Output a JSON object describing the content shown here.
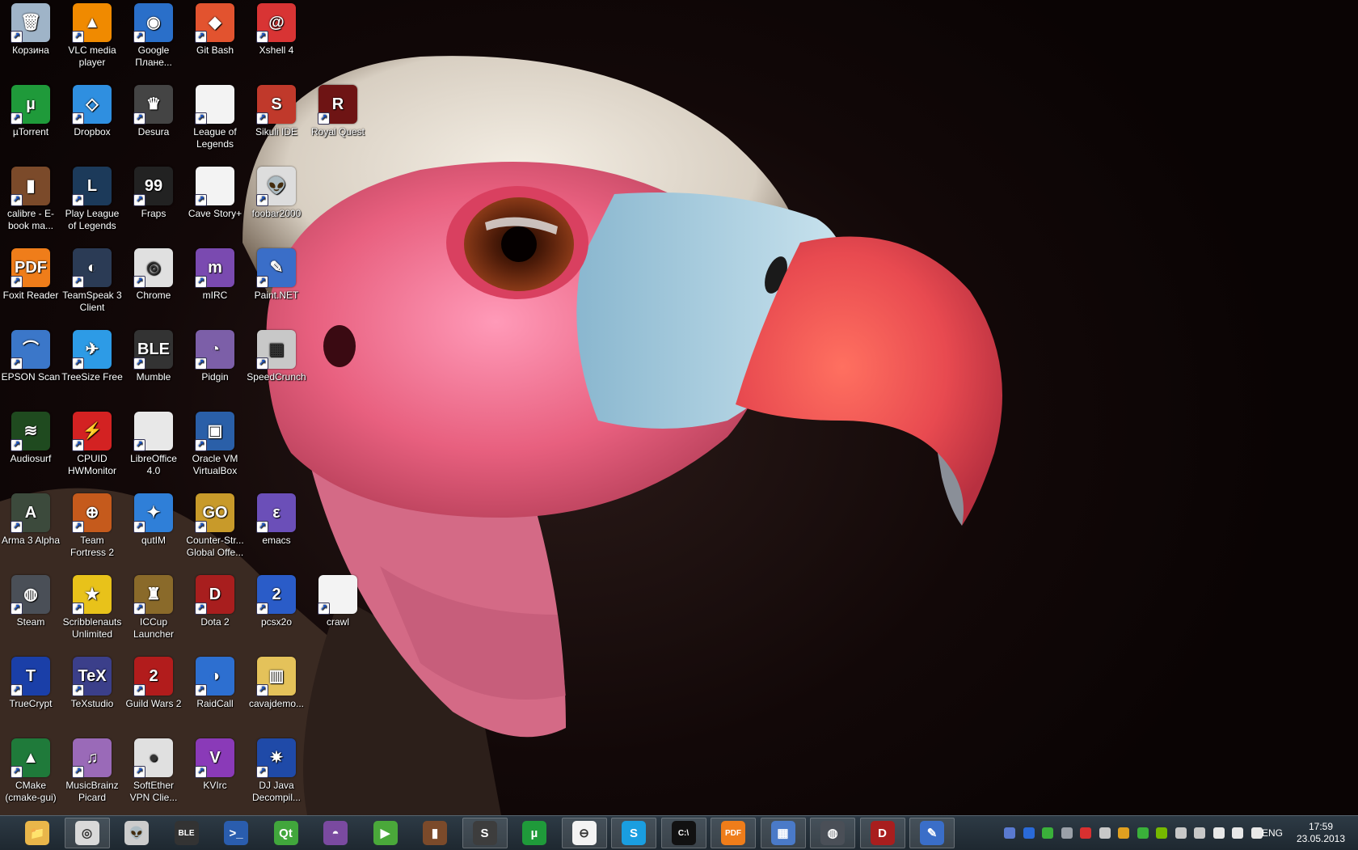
{
  "desktop": {
    "icons": [
      {
        "label": "Корзина",
        "icon": "recycle-bin-icon",
        "color": "#9fb4c8",
        "glyph": "🗑"
      },
      {
        "label": "VLC media player",
        "icon": "vlc-icon",
        "color": "#f08a00",
        "glyph": "▲"
      },
      {
        "label": "Google Плане...",
        "icon": "google-earth-icon",
        "color": "#2a6fc9",
        "glyph": "◉"
      },
      {
        "label": "Git Bash",
        "icon": "git-bash-icon",
        "color": "#e2532f",
        "glyph": "◆"
      },
      {
        "label": "Xshell 4",
        "icon": "xshell-icon",
        "color": "#d83434",
        "glyph": "@"
      },
      {
        "label": "µTorrent",
        "icon": "utorrent-icon",
        "color": "#1f9a3a",
        "glyph": "µ"
      },
      {
        "label": "Dropbox",
        "icon": "dropbox-icon",
        "color": "#2f8fe0",
        "glyph": "◇"
      },
      {
        "label": "Desura",
        "icon": "desura-icon",
        "color": "#444444",
        "glyph": "♛"
      },
      {
        "label": "League of Legends",
        "icon": "file-icon",
        "color": "#f3f3f3",
        "glyph": ""
      },
      {
        "label": "Sikuli IDE",
        "icon": "sikuli-icon",
        "color": "#c0392b",
        "glyph": "S"
      },
      {
        "label": "Royal Quest",
        "icon": "royal-quest-icon",
        "color": "#6e1414",
        "glyph": "R"
      },
      {
        "label": "calibre - E-book ma...",
        "icon": "calibre-icon",
        "color": "#7b4a2a",
        "glyph": "▮"
      },
      {
        "label": "Play League of Legends",
        "icon": "league-icon",
        "color": "#1c3a5a",
        "glyph": "L"
      },
      {
        "label": "Fraps",
        "icon": "fraps-icon",
        "color": "#222222",
        "glyph": "99"
      },
      {
        "label": "Cave Story+",
        "icon": "file-icon",
        "color": "#f3f3f3",
        "glyph": ""
      },
      {
        "label": "foobar2000",
        "icon": "foobar-icon",
        "color": "#dddddd",
        "glyph": "👽"
      },
      {
        "label": "Foxit Reader",
        "icon": "foxit-icon",
        "color": "#ef7d1a",
        "glyph": "PDF"
      },
      {
        "label": "TeamSpeak 3 Client",
        "icon": "teamspeak-icon",
        "color": "#2b3b55",
        "glyph": "◐"
      },
      {
        "label": "Chrome",
        "icon": "chrome-icon",
        "color": "#e0e0e0",
        "glyph": "◎"
      },
      {
        "label": "mIRC",
        "icon": "mirc-icon",
        "color": "#7a4ab0",
        "glyph": "m"
      },
      {
        "label": "Paint.NET",
        "icon": "paintnet-icon",
        "color": "#3a6ec8",
        "glyph": "✎"
      },
      {
        "label": "EPSON Scan",
        "icon": "epson-icon",
        "color": "#3b77c9",
        "glyph": "⌒"
      },
      {
        "label": "TreeSize Free",
        "icon": "treesize-icon",
        "color": "#2d9be6",
        "glyph": "✈"
      },
      {
        "label": "Mumble",
        "icon": "mumble-icon",
        "color": "#333333",
        "glyph": "BLE"
      },
      {
        "label": "Pidgin",
        "icon": "pidgin-icon",
        "color": "#7c5fa8",
        "glyph": "◔"
      },
      {
        "label": "SpeedCrunch",
        "icon": "speedcrunch-icon",
        "color": "#c8c8c8",
        "glyph": "▦"
      },
      {
        "label": "Audiosurf",
        "icon": "audiosurf-icon",
        "color": "#1f4a1f",
        "glyph": "≋"
      },
      {
        "label": "CPUID HWMonitor",
        "icon": "hwmonitor-icon",
        "color": "#d32222",
        "glyph": "⚡"
      },
      {
        "label": "LibreOffice 4.0",
        "icon": "libreoffice-icon",
        "color": "#e8e8e8",
        "glyph": ""
      },
      {
        "label": "Oracle VM VirtualBox",
        "icon": "virtualbox-icon",
        "color": "#2a5fa8",
        "glyph": "▣"
      },
      {
        "label": "Arma 3 Alpha",
        "icon": "arma-icon",
        "color": "#3c4a3c",
        "glyph": "A"
      },
      {
        "label": "Team Fortress 2",
        "icon": "tf2-icon",
        "color": "#c55a1c",
        "glyph": "⊕"
      },
      {
        "label": "qutIM",
        "icon": "qutim-icon",
        "color": "#2f7fd8",
        "glyph": "✦"
      },
      {
        "label": "Counter-Str... Global Offe...",
        "icon": "csgo-icon",
        "color": "#c89a2a",
        "glyph": "GO"
      },
      {
        "label": "emacs",
        "icon": "emacs-icon",
        "color": "#6b4fb8",
        "glyph": "ε"
      },
      {
        "label": "Steam",
        "icon": "steam-icon",
        "color": "#4a4f57",
        "glyph": "◍"
      },
      {
        "label": "Scribblenauts Unlimited",
        "icon": "scribblenauts-icon",
        "color": "#e8c21a",
        "glyph": "★"
      },
      {
        "label": "ICCup Launcher",
        "icon": "iccup-icon",
        "color": "#8a6a2a",
        "glyph": "♜"
      },
      {
        "label": "Dota 2",
        "icon": "dota2-icon",
        "color": "#a81e1e",
        "glyph": "D"
      },
      {
        "label": "pcsx2o",
        "icon": "pcsx2-icon",
        "color": "#2a5cc8",
        "glyph": "2"
      },
      {
        "label": "crawl",
        "icon": "file-icon",
        "color": "#f3f3f3",
        "glyph": ""
      },
      {
        "label": "TrueCrypt",
        "icon": "truecrypt-icon",
        "color": "#1a3fa8",
        "glyph": "T"
      },
      {
        "label": "TeXstudio",
        "icon": "texstudio-icon",
        "color": "#3b3f8a",
        "glyph": "TeX"
      },
      {
        "label": "Guild Wars 2",
        "icon": "guildwars2-icon",
        "color": "#b21c1c",
        "glyph": "2"
      },
      {
        "label": "RaidCall",
        "icon": "raidcall-icon",
        "color": "#2d6fd0",
        "glyph": "◑"
      },
      {
        "label": "cavajdemo...",
        "icon": "folder-zip-icon",
        "color": "#e4c25a",
        "glyph": "▥"
      },
      {
        "label": "CMake (cmake-gui)",
        "icon": "cmake-icon",
        "color": "#1f7a3a",
        "glyph": "▲"
      },
      {
        "label": "MusicBrainz Picard",
        "icon": "picard-icon",
        "color": "#9a6ab8",
        "glyph": "♫"
      },
      {
        "label": "SoftEther VPN Clie...",
        "icon": "softether-icon",
        "color": "#e0e0e0",
        "glyph": "●"
      },
      {
        "label": "KVIrc",
        "icon": "kvirc-icon",
        "color": "#8a3ab8",
        "glyph": "V"
      },
      {
        "label": "DJ Java Decompil...",
        "icon": "djjava-icon",
        "color": "#1f4aa8",
        "glyph": "✷"
      }
    ]
  },
  "taskbar": {
    "buttons": [
      {
        "name": "explorer-icon",
        "color": "#e9b64a",
        "glyph": "📁",
        "open": false
      },
      {
        "name": "chrome-icon",
        "color": "#d9d9d9",
        "glyph": "◎",
        "open": true
      },
      {
        "name": "foobar-icon",
        "color": "#cccccc",
        "glyph": "👽",
        "open": false
      },
      {
        "name": "mumble-icon",
        "color": "#333333",
        "glyph": "BLE",
        "open": false
      },
      {
        "name": "powershell-icon",
        "color": "#2a5dae",
        "glyph": ">_",
        "open": false
      },
      {
        "name": "qt-creator-icon",
        "color": "#41a63c",
        "glyph": "Qt",
        "open": false
      },
      {
        "name": "tor-icon",
        "color": "#7a4aa0",
        "glyph": "◓",
        "open": false
      },
      {
        "name": "media-player-icon",
        "color": "#4aa83a",
        "glyph": "▶",
        "open": false
      },
      {
        "name": "calibre-icon",
        "color": "#7b4a2a",
        "glyph": "▮",
        "open": false
      },
      {
        "name": "sublime-icon",
        "color": "#3d3d3d",
        "glyph": "S",
        "open": true
      },
      {
        "name": "utorrent-icon",
        "color": "#1f9a3a",
        "glyph": "µ",
        "open": false
      },
      {
        "name": "document-icon",
        "color": "#f3f3f3",
        "glyph": "⊖",
        "open": true
      },
      {
        "name": "skype-icon",
        "color": "#1a9ee0",
        "glyph": "S",
        "open": true
      },
      {
        "name": "cmd-icon",
        "color": "#111111",
        "glyph": "C:\\",
        "open": true
      },
      {
        "name": "foxit-icon",
        "color": "#ef7d1a",
        "glyph": "PDF",
        "open": true
      },
      {
        "name": "control-panel-icon",
        "color": "#4a7ac8",
        "glyph": "▦",
        "open": true
      },
      {
        "name": "steam-icon",
        "color": "#4a4f57",
        "glyph": "◍",
        "open": true
      },
      {
        "name": "dota2-icon",
        "color": "#a81e1e",
        "glyph": "D",
        "open": true
      },
      {
        "name": "paintnet-icon",
        "color": "#3a6ec8",
        "glyph": "✎",
        "open": true
      }
    ],
    "tray": {
      "icons": [
        {
          "name": "network-app-icon",
          "color": "#5a7ad0"
        },
        {
          "name": "security-icon",
          "color": "#2a6ad8"
        },
        {
          "name": "shield-icon",
          "color": "#3ab03a"
        },
        {
          "name": "steam-tray-icon",
          "color": "#9aa0a8"
        },
        {
          "name": "os-icon",
          "color": "#d83030"
        },
        {
          "name": "gear-icon",
          "color": "#c8c8c8"
        },
        {
          "name": "weather-icon",
          "color": "#e0a020"
        },
        {
          "name": "update-icon",
          "color": "#3ab03a"
        },
        {
          "name": "nvidia-icon",
          "color": "#76b900"
        },
        {
          "name": "display-icon",
          "color": "#c8c8c8"
        },
        {
          "name": "brush-icon",
          "color": "#c8c8c8"
        },
        {
          "name": "flag-icon",
          "color": "#e8e8e8"
        },
        {
          "name": "network-icon",
          "color": "#e8e8e8"
        },
        {
          "name": "volume-icon",
          "color": "#e8e8e8"
        }
      ],
      "language": "ENG",
      "time": "17:59",
      "date": "23.05.2013"
    }
  }
}
